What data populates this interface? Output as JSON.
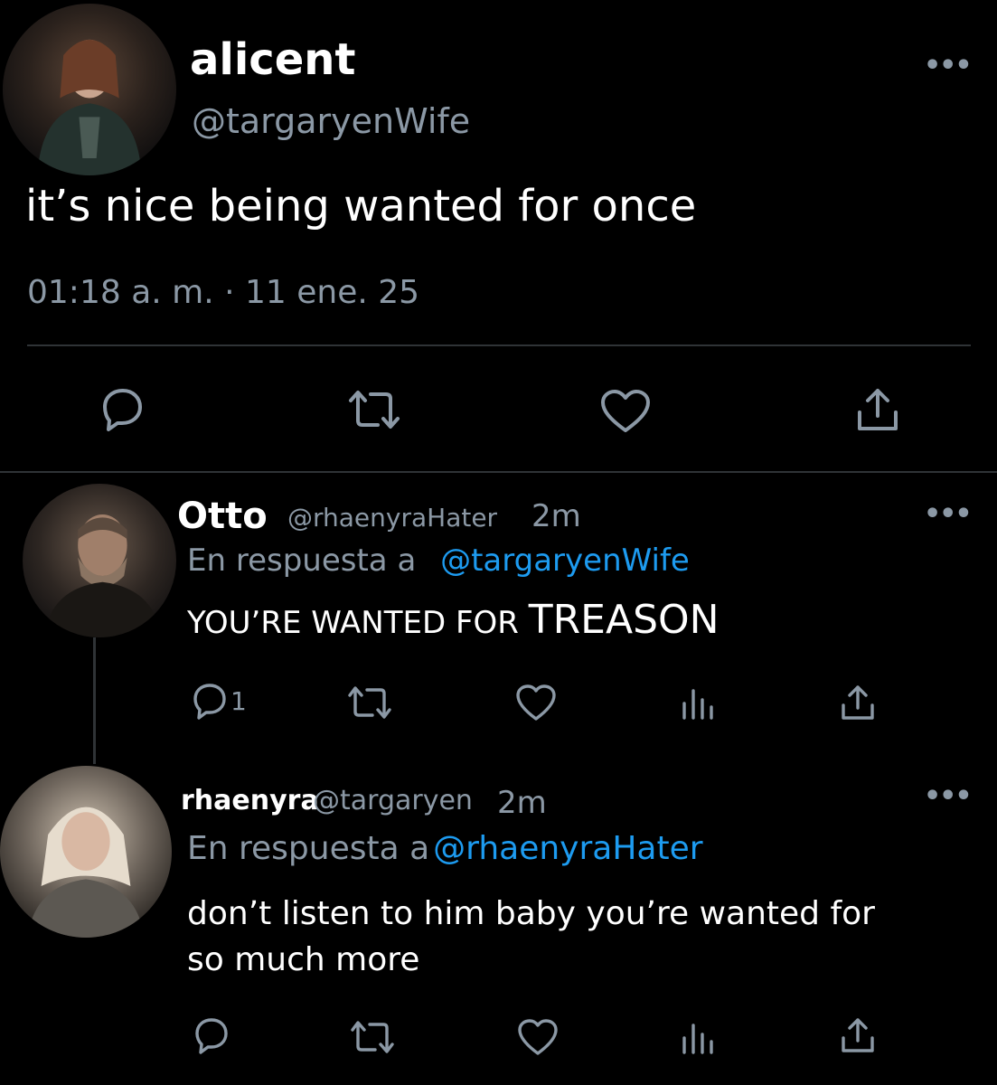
{
  "main_tweet": {
    "display_name": "alicent",
    "handle": "@targaryenWife",
    "text": "it’s nice being wanted for once",
    "timestamp": "01:18 a. m. · 11 ene. 25",
    "more_label": "•••"
  },
  "replies": [
    {
      "display_name": "Otto",
      "handle": "@rhaenyraHater",
      "time": "2m",
      "reply_to_label": "En respuesta a",
      "reply_to_handle": "@targaryenWife",
      "text_part1": "YOU’RE WANTED FOR ",
      "text_part2": "TREASON",
      "reply_count": "1",
      "more_label": "•••"
    },
    {
      "display_name": "rhaenyra",
      "handle": "@targaryen",
      "time": "2m",
      "reply_to_label": "En respuesta a",
      "reply_to_handle": "@rhaenyraHater",
      "text_line1": "don’t listen to him baby you’re wanted for",
      "text_line2": "so much more",
      "more_label": "•••"
    }
  ],
  "icons": {
    "reply": "reply-icon",
    "retweet": "retweet-icon",
    "like": "heart-icon",
    "share": "share-icon",
    "views": "views-icon",
    "more": "more-icon"
  },
  "colors": {
    "background": "#000000",
    "text": "#ffffff",
    "secondary": "#8b98a5",
    "link": "#1d9bf0",
    "divider": "#2f3336"
  }
}
